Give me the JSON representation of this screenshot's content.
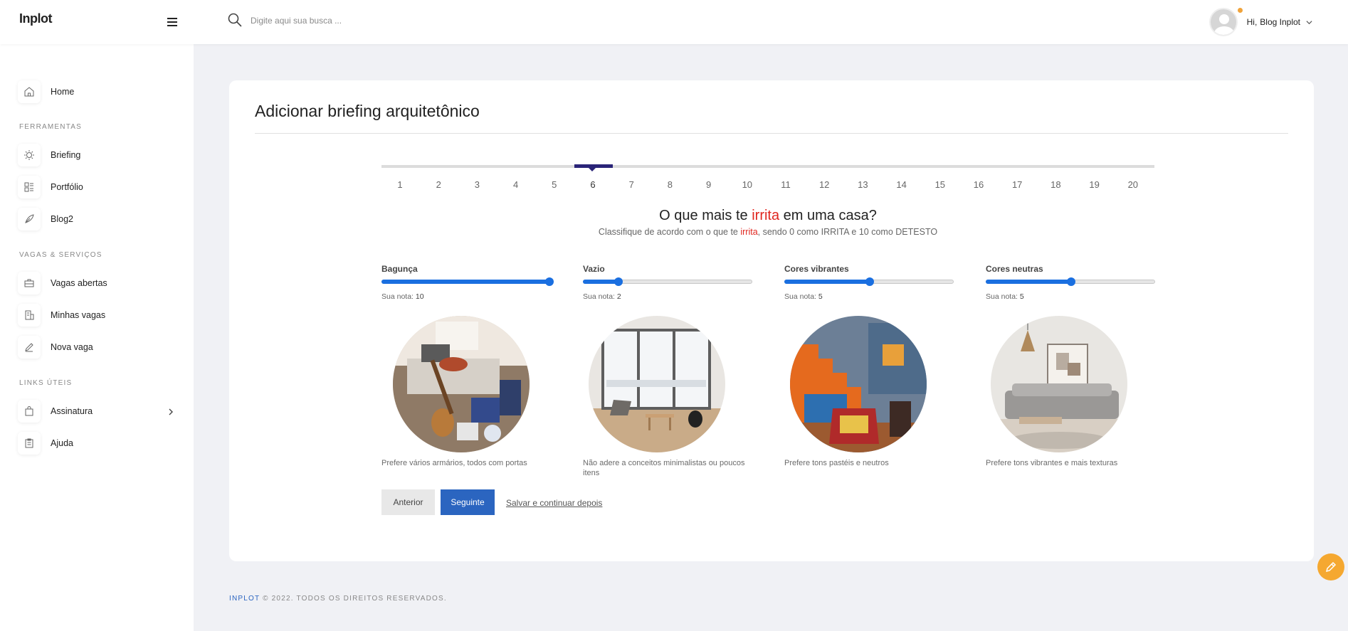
{
  "header": {
    "logo": "Inplot",
    "search_placeholder": "Digite aqui sua busca ...",
    "greeting": "Hi,",
    "user_name": "Blog Inplot"
  },
  "sidebar": {
    "home": "Home",
    "section_tools": "FERRAMENTAS",
    "briefing": "Briefing",
    "portfolio": "Portfólio",
    "blog": "Blog2",
    "section_jobs": "VAGAS & SERVIÇOS",
    "open_jobs": "Vagas abertas",
    "my_jobs": "Minhas vagas",
    "new_job": "Nova vaga",
    "section_links": "LINKS ÚTEIS",
    "subscription": "Assinatura",
    "help": "Ajuda"
  },
  "card": {
    "title": "Adicionar briefing arquitetônico",
    "current_step": 6,
    "steps": [
      "1",
      "2",
      "3",
      "4",
      "5",
      "6",
      "7",
      "8",
      "9",
      "10",
      "11",
      "12",
      "13",
      "14",
      "15",
      "16",
      "17",
      "18",
      "19",
      "20"
    ],
    "question_pre": "O que mais te ",
    "question_hl": "irrita",
    "question_post": " em uma casa?",
    "sub_pre": "Classifique de acordo com o que te ",
    "sub_hl": "irrita",
    "sub_post": ", sendo 0 como IRRITA e 10 como DETESTO",
    "nota_label": "Sua nota:",
    "options": [
      {
        "label": "Bagunça",
        "value": 10,
        "value_text": "10",
        "desc": "Prefere vários armários, todos com portas"
      },
      {
        "label": "Vazio",
        "value": 2,
        "value_text": "2",
        "desc": "Não adere a conceitos minimalistas ou poucos itens"
      },
      {
        "label": "Cores vibrantes",
        "value": 5,
        "value_text": "5",
        "desc": "Prefere tons pastéis e neutros"
      },
      {
        "label": "Cores neutras",
        "value": 5,
        "value_text": "5",
        "desc": "Prefere tons vibrantes e mais texturas"
      }
    ],
    "slider_max": 10,
    "btn_prev": "Anterior",
    "btn_next": "Seguinte",
    "save_later": "Salvar e continuar depois"
  },
  "footer": {
    "brand": "INPLOT",
    "text": " © 2022. TODOS OS DIREITOS RESERVADOS."
  },
  "colors": {
    "accent": "#1a6fe0",
    "primary_button": "#2b65c0",
    "highlight": "#e0261f",
    "step_active": "#2a2478",
    "fab": "#f5a830"
  }
}
